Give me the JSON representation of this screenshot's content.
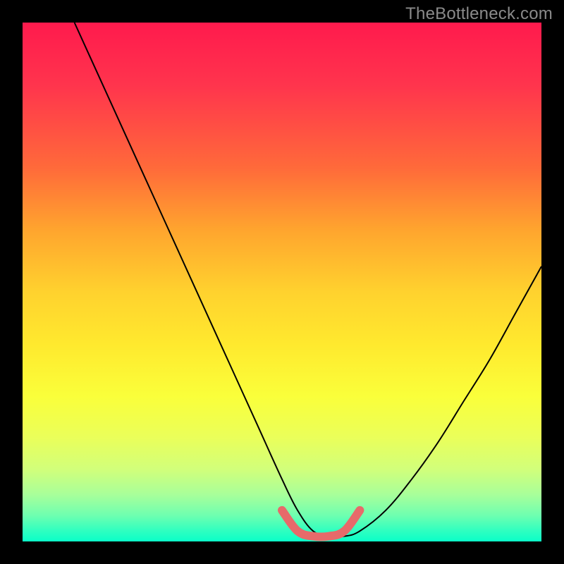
{
  "watermark": "TheBottleneck.com",
  "chart_data": {
    "type": "line",
    "title": "",
    "xlabel": "",
    "ylabel": "",
    "xlim": [
      0,
      100
    ],
    "ylim": [
      0,
      100
    ],
    "series": [
      {
        "name": "main-curve",
        "x": [
          10,
          15,
          20,
          25,
          30,
          35,
          40,
          45,
          50,
          53,
          56,
          59,
          62,
          65,
          70,
          75,
          80,
          85,
          90,
          95,
          100
        ],
        "y": [
          100,
          89,
          78,
          67,
          56,
          45,
          34,
          23,
          12,
          6,
          2,
          1,
          1,
          2,
          6,
          12,
          19,
          27,
          35,
          44,
          53
        ]
      },
      {
        "name": "bottom-marker",
        "x": [
          50,
          53,
          56,
          59,
          62,
          65
        ],
        "y": [
          6,
          2,
          1,
          1,
          2,
          6
        ]
      }
    ],
    "gradient_stops": [
      {
        "pos": 0,
        "color": "#ff1a4d"
      },
      {
        "pos": 12,
        "color": "#ff344d"
      },
      {
        "pos": 28,
        "color": "#ff6a3a"
      },
      {
        "pos": 40,
        "color": "#ffa52e"
      },
      {
        "pos": 52,
        "color": "#ffd22e"
      },
      {
        "pos": 62,
        "color": "#ffe92e"
      },
      {
        "pos": 72,
        "color": "#faff3a"
      },
      {
        "pos": 80,
        "color": "#eaff5a"
      },
      {
        "pos": 86,
        "color": "#d2ff7a"
      },
      {
        "pos": 91,
        "color": "#a8ff9a"
      },
      {
        "pos": 95,
        "color": "#6effb0"
      },
      {
        "pos": 98,
        "color": "#2effc0"
      },
      {
        "pos": 100,
        "color": "#0affc8"
      }
    ],
    "marker_color": "#e76a6a",
    "curve_color": "#000000"
  }
}
